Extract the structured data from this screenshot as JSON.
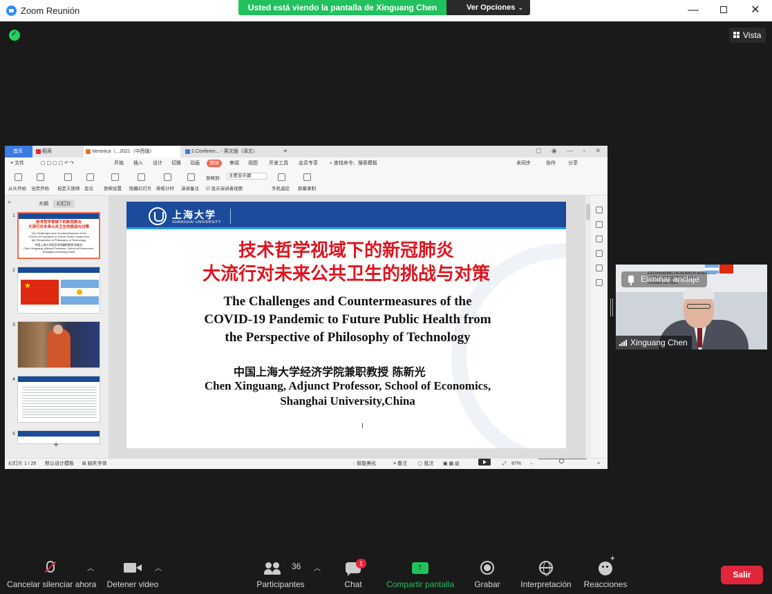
{
  "window": {
    "title": "Zoom Reunión",
    "share_banner": "Usted está viendo la pantalla de Xinguang Chen",
    "view_options": "Ver Opciones",
    "view_button": "Vista"
  },
  "wps": {
    "tabs": [
      "首页",
      "稻壳",
      "Veronica（...2021（中西版）",
      "2.Conferen... - 英文版（译文）"
    ],
    "menu": [
      "文件",
      "开始",
      "插入",
      "设计",
      "切换",
      "动画",
      "放映",
      "审阅",
      "视图",
      "开发工具",
      "会员专享",
      "查找命令、搜索模板",
      "未同步",
      "协作",
      "分享"
    ],
    "ribbon": [
      "从头开始",
      "当页开始",
      "自定义放映",
      "会议",
      "放映设置",
      "隐藏幻灯片",
      "排练计时",
      "演讲备注",
      "放映到:",
      "主要显示器",
      "显示演讲者视图",
      "手机遥控",
      "屏幕录制"
    ],
    "pane_tabs": [
      "大纲",
      "幻灯片"
    ],
    "thumb_numbers": [
      "1",
      "2",
      "3",
      "4",
      "5"
    ],
    "status": {
      "slide_count": "幻灯片 1 / 26",
      "template": "默认设计模板",
      "missing_font": "缺失字体",
      "smart_beautify": "智能美化",
      "notes": "备注",
      "comments": "批注",
      "zoom": "87%"
    }
  },
  "slide": {
    "university_cn": "上海大学",
    "university_en": "SHANGHAI UNIVERSITY",
    "title_cn_line1": "技术哲学视域下的新冠肺炎",
    "title_cn_line2": "大流行对未来公共卫生的挑战与对策",
    "title_en_line1": "The Challenges and Countermeasures of the",
    "title_en_line2": "COVID-19 Pandemic to Future Public Health from",
    "title_en_line3": "the Perspective of Philosophy of Technology",
    "author_cn": "中国上海大学经济学院兼职教授   陈新光",
    "author_en_line1": "Chen Xinguang, Adjunct Professor, School of Economics,",
    "author_en_line2": "Shanghai University,China"
  },
  "video": {
    "unpin_label": "Eliminar anclaje",
    "participant_name": "Xinguang Chen"
  },
  "toolbar": {
    "mute": "Cancelar silenciar ahora",
    "stop_video": "Detener video",
    "participants": "Participantes",
    "participant_count": "36",
    "chat": "Chat",
    "chat_badge": "1",
    "share": "Compartir pantalla",
    "record": "Grabar",
    "interpretation": "Interpretación",
    "reactions": "Reacciones",
    "leave": "Salir"
  },
  "colors": {
    "zoom_blue": "#2d8cff",
    "share_green": "#21c15e",
    "leave_red": "#e0263d",
    "slide_red": "#e0141e",
    "slide_header_blue": "#1c4b9c"
  }
}
